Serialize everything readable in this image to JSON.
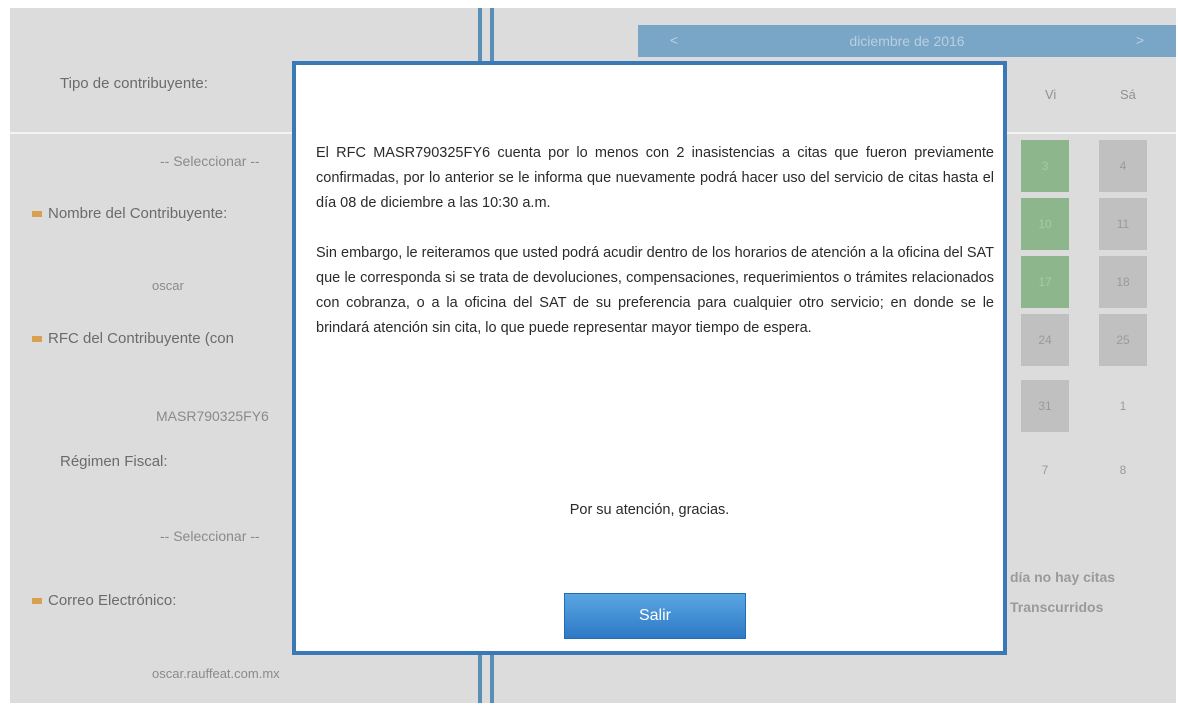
{
  "form": {
    "tipo_label": "Tipo de contribuyente:",
    "tipo_select": "-- Seleccionar --",
    "nombre_label": "Nombre del Contribuyente:",
    "nombre_value": "oscar",
    "rfc_label": "RFC del Contribuyente (con",
    "rfc_value": "MASR790325FY6",
    "regimen_label": "Régimen Fiscal:",
    "regimen_select": "-- Seleccionar --",
    "correo_label": "Correo Electrónico:",
    "correo_value": "oscar.rauffeat.com.mx"
  },
  "calendar": {
    "prev": "<",
    "month_title": "diciembre de 2016",
    "next": ">",
    "dow": [
      "Vi",
      "Sá"
    ],
    "rows": [
      [
        "3",
        "4"
      ],
      [
        "10",
        "11"
      ],
      [
        "17",
        "18"
      ],
      [
        "24",
        "25"
      ],
      [
        "31",
        "1"
      ],
      [
        "7",
        "8"
      ]
    ],
    "note_line1": "día no hay citas",
    "note_line2": "Transcurridos"
  },
  "modal": {
    "paragraph1": "El RFC MASR790325FY6 cuenta por lo menos con 2 inasistencias a citas que fueron previamente confirmadas, por lo anterior se le informa que nuevamente podrá hacer uso del servicio de citas hasta el día 08 de diciembre a las 10:30 a.m.",
    "paragraph2": "Sin embargo, le reiteramos que usted podrá acudir dentro de los horarios de atención a la oficina del SAT que le corresponda si se trata de devoluciones, compensaciones, requerimientos o trámites relacionados con cobranza, o a la oficina del SAT de su preferencia para cualquier otro servicio; en donde se le brindará atención sin cita, lo que puede representar mayor tiempo de espera.",
    "thanks": "Por su atención, gracias.",
    "exit_button": "Salir"
  },
  "colors": {
    "modal_border": "#3b79b6",
    "button": "#2c79c6",
    "available_day": "#8db68d",
    "unavailable_day": "#c0c0c0",
    "calendar_header": "#79a6c7"
  }
}
